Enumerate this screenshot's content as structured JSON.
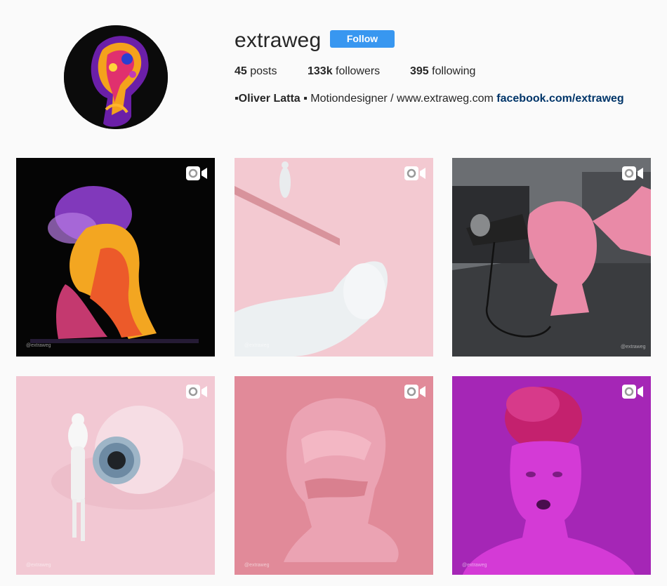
{
  "profile": {
    "username": "extraweg",
    "follow_label": "Follow",
    "stats": {
      "posts_count": "45",
      "posts_label": "posts",
      "followers_count": "133k",
      "followers_label": "followers",
      "following_count": "395",
      "following_label": "following"
    },
    "bio": {
      "name": "▪Oliver Latta ▪",
      "text": " Motiondesigner / www.extraweg.com ",
      "link": "facebook.com/extraweg"
    }
  },
  "posts": [
    {
      "watermark": "@extraweg",
      "icon": "video-icon"
    },
    {
      "watermark": "@extraweg",
      "icon": "video-icon"
    },
    {
      "watermark": "@extraweg",
      "icon": "video-icon"
    },
    {
      "watermark": "@extraweg",
      "icon": "video-icon"
    },
    {
      "watermark": "@extraweg",
      "icon": "video-icon"
    },
    {
      "watermark": "@extraweg",
      "icon": "video-icon"
    }
  ],
  "colors": {
    "follow_button": "#3897f0",
    "link": "#003569",
    "background": "#fafafa"
  }
}
